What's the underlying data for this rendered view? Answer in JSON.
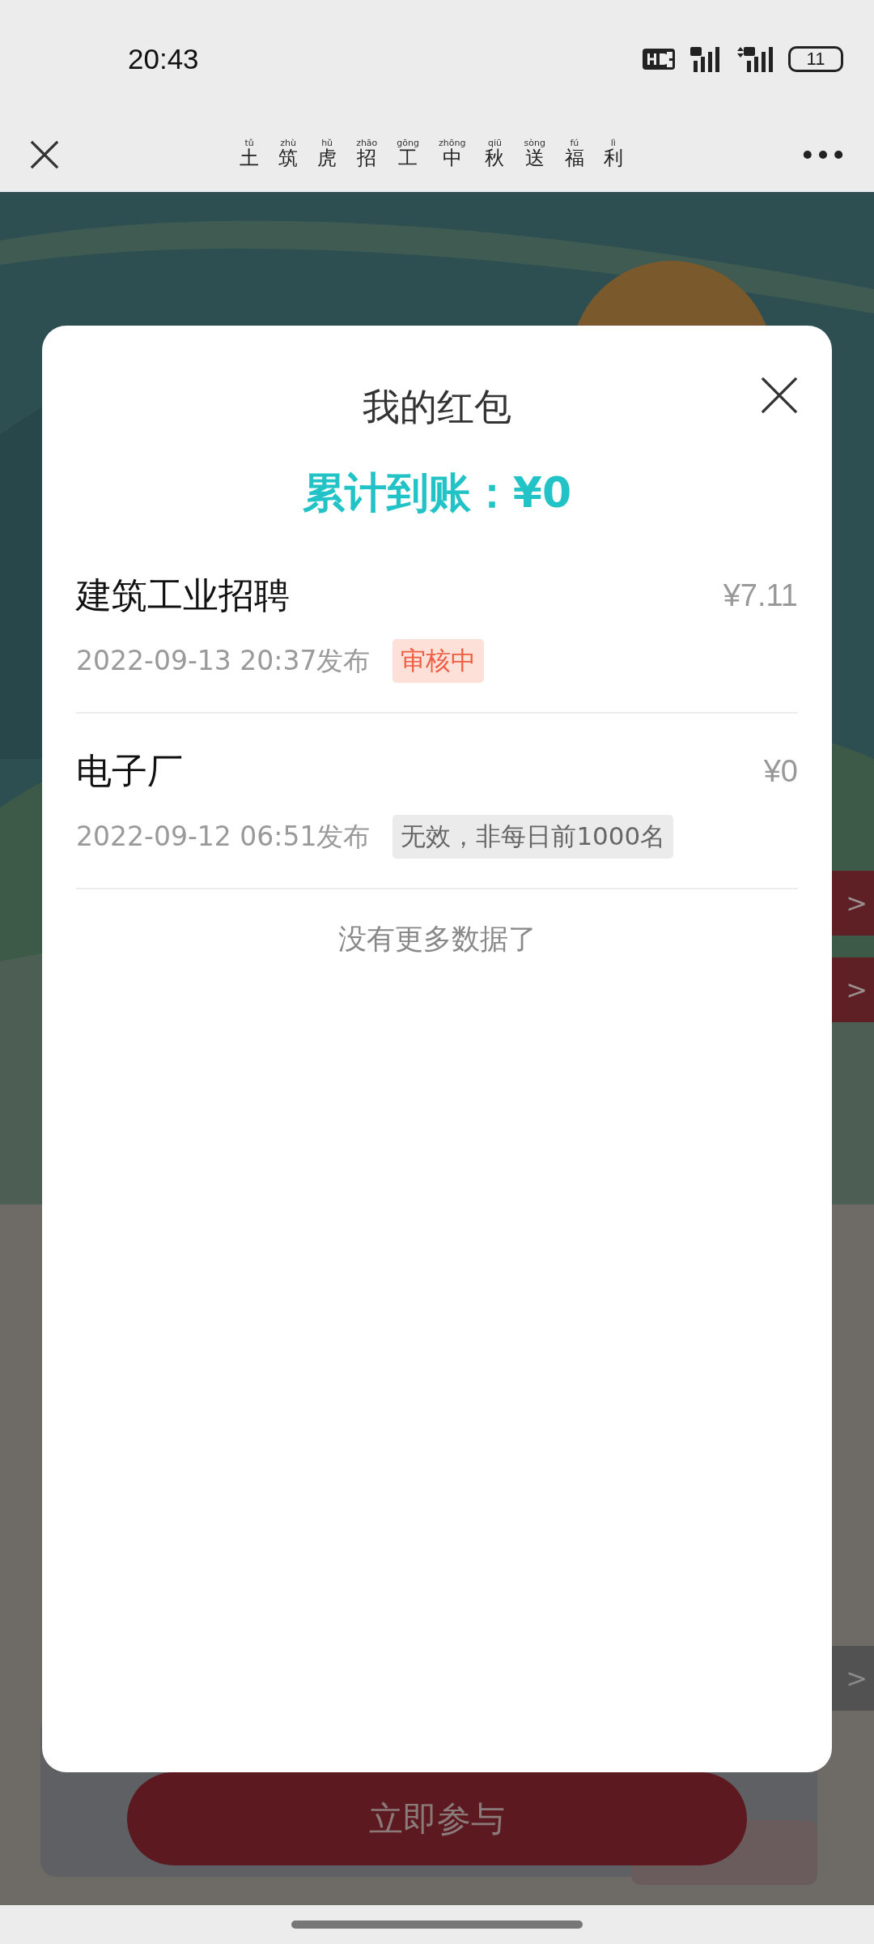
{
  "status_bar": {
    "time": "20:43",
    "battery": "11"
  },
  "nav_bar": {
    "title": [
      {
        "hanzi": "土",
        "pinyin": "tǔ"
      },
      {
        "hanzi": "筑",
        "pinyin": "zhù"
      },
      {
        "hanzi": "虎",
        "pinyin": "hǔ"
      },
      {
        "hanzi": "招",
        "pinyin": "zhāo"
      },
      {
        "hanzi": "工",
        "pinyin": "gōng"
      },
      {
        "hanzi": "中",
        "pinyin": "zhōng"
      },
      {
        "hanzi": "秋",
        "pinyin": "qiū"
      },
      {
        "hanzi": "送",
        "pinyin": "sòng"
      },
      {
        "hanzi": "福",
        "pinyin": "fú"
      },
      {
        "hanzi": "利",
        "pinyin": "lì"
      }
    ]
  },
  "background": {
    "kind": "picture",
    "side_tabs": [
      {
        "label": ">",
        "kind": "red"
      },
      {
        "label": ">",
        "kind": "red"
      },
      {
        "label": ">",
        "kind": "grey"
      }
    ],
    "join_button": "立即参与"
  },
  "dialog": {
    "title": "我的红包",
    "total": "累计到账：¥0",
    "items": [
      {
        "name": "建筑工业招聘",
        "amount": "¥7.11",
        "date": "2022-09-13 20:37发布",
        "tag": "审核中",
        "kind": "pending"
      },
      {
        "name": "电子厂",
        "amount": "¥0",
        "date": "2022-09-12 06:51发布",
        "tag": "无效，非每日前1000名",
        "kind": "invalid"
      }
    ],
    "end_note": "没有更多数据了"
  }
}
